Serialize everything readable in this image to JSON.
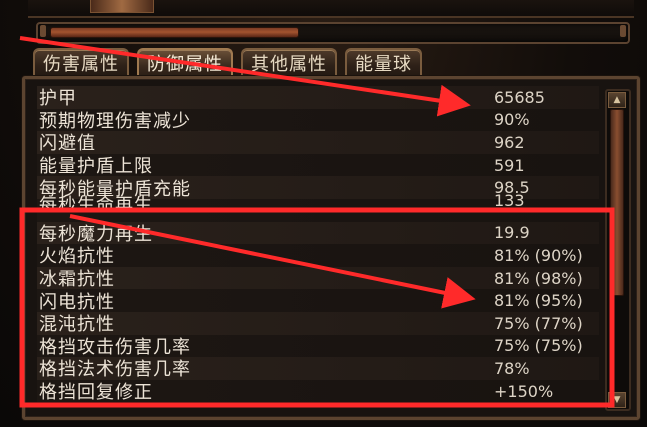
{
  "tabs": [
    {
      "label": "伤害属性",
      "active": false
    },
    {
      "label": "防御属性",
      "active": true
    },
    {
      "label": "其他属性",
      "active": false
    },
    {
      "label": "能量球",
      "active": false
    }
  ],
  "exp_bar": {
    "fill_fraction": 0.44
  },
  "stats": [
    {
      "label": "护甲",
      "value": "65685"
    },
    {
      "label": "预期物理伤害减少",
      "value": "90%"
    },
    {
      "label": "闪避值",
      "value": "962"
    },
    {
      "label": "能量护盾上限",
      "value": "591"
    },
    {
      "label": "每秒能量护盾充能",
      "value": "98.5"
    },
    {
      "label": "每秒生命再生",
      "value": "133"
    },
    {
      "label": "每秒魔力再生",
      "value": "19.9"
    },
    {
      "label": "火焰抗性",
      "value": "81% (90%)"
    },
    {
      "label": "冰霜抗性",
      "value": "81% (98%)"
    },
    {
      "label": "闪电抗性",
      "value": "81% (95%)"
    },
    {
      "label": "混沌抗性",
      "value": "75% (77%)"
    },
    {
      "label": "格挡攻击伤害几率",
      "value": "75% (75%)"
    },
    {
      "label": "格挡法术伤害几率",
      "value": "78%"
    },
    {
      "label": "格挡回复修正",
      "value": "+150%"
    }
  ],
  "annotation": {
    "color": "#ff2a2a"
  }
}
